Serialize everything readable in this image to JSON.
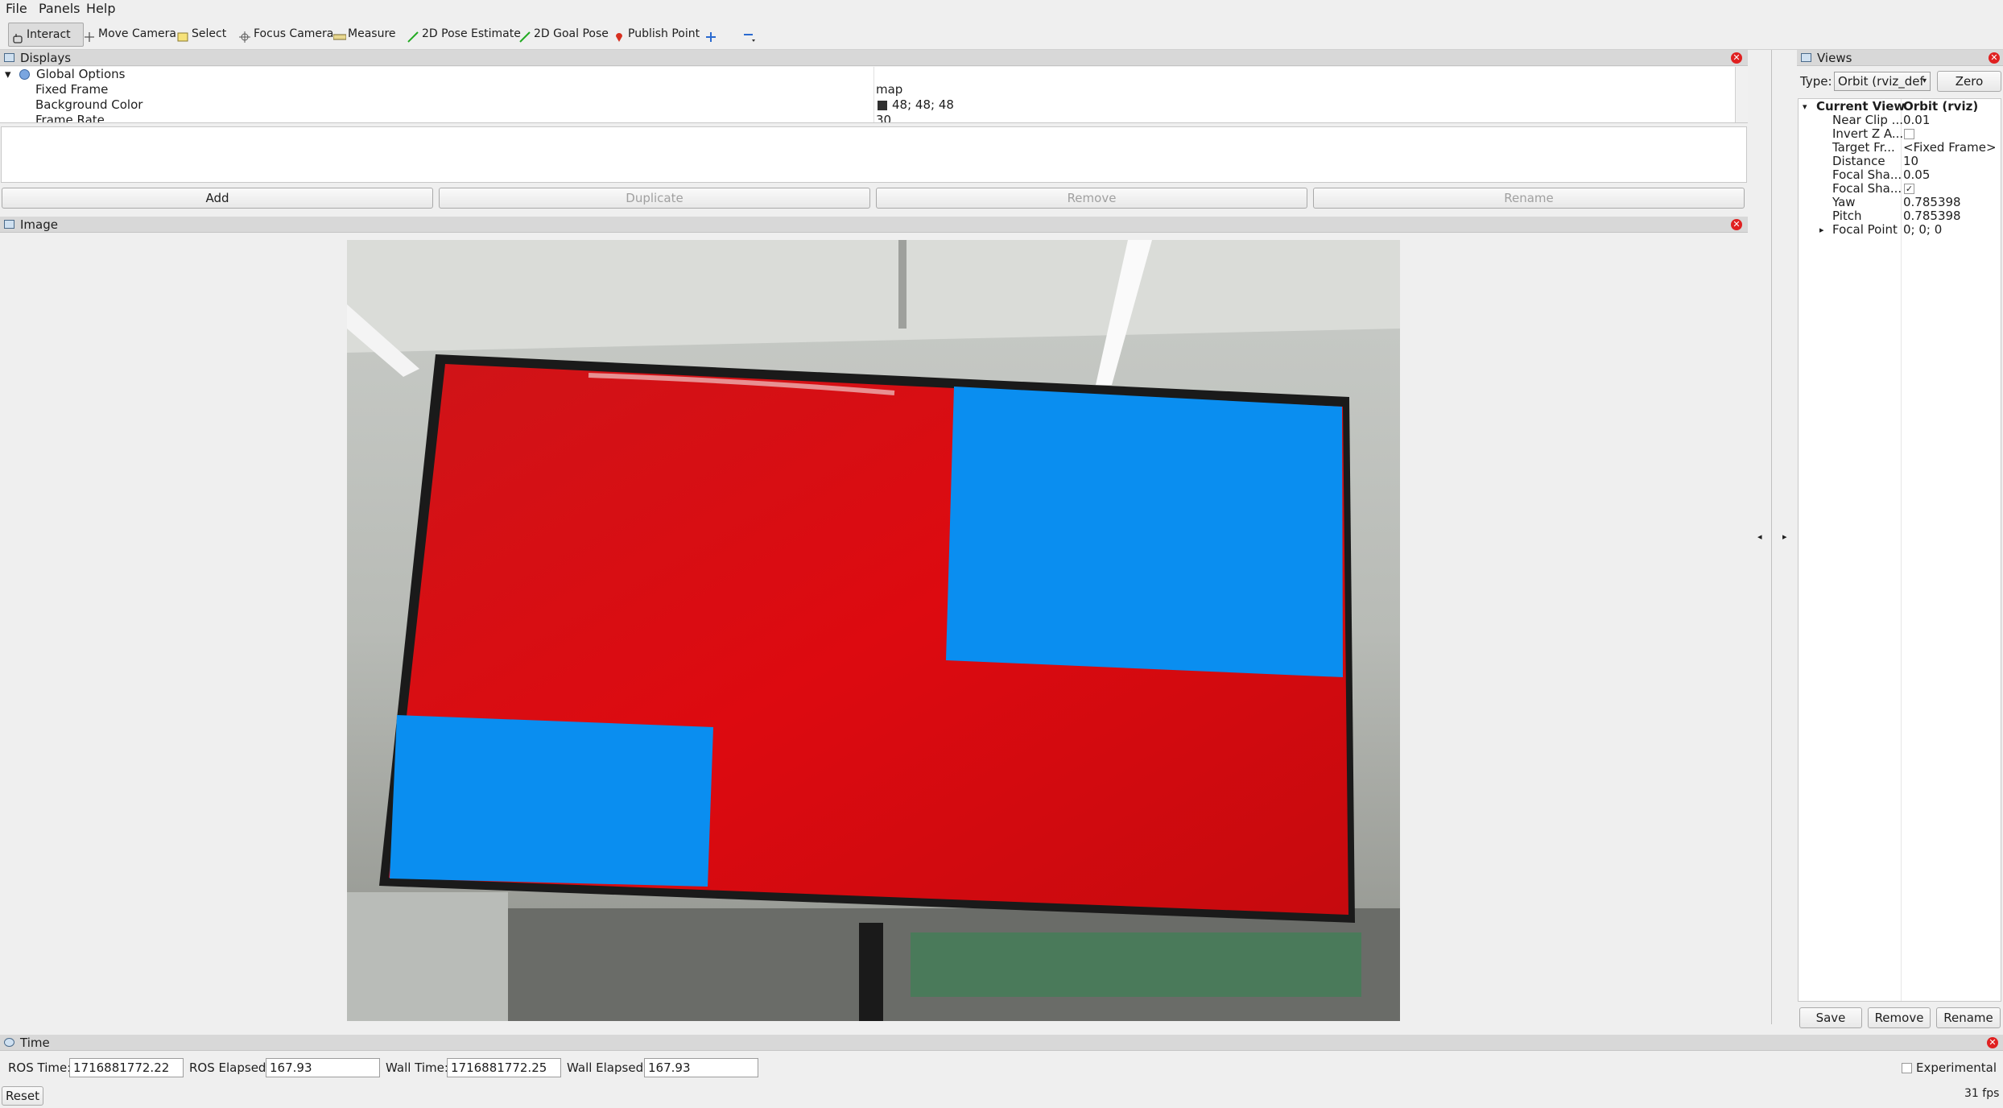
{
  "menu": {
    "file": "File",
    "panels": "Panels",
    "help": "Help"
  },
  "toolbar": {
    "interact": "Interact",
    "move_camera": "Move Camera",
    "select": "Select",
    "focus_camera": "Focus Camera",
    "measure": "Measure",
    "pose_estimate": "2D Pose Estimate",
    "goal_pose": "2D Goal Pose",
    "publish_point": "Publish Point"
  },
  "displays": {
    "title": "Displays",
    "global_options": "Global Options",
    "rows": [
      {
        "name": "Fixed Frame",
        "value": "map"
      },
      {
        "name": "Background Color",
        "value": "48; 48; 48",
        "swatch": "#303030"
      },
      {
        "name": "Frame Rate",
        "value": "30"
      }
    ],
    "buttons": {
      "add": "Add",
      "duplicate": "Duplicate",
      "remove": "Remove",
      "rename": "Rename"
    }
  },
  "image_panel": {
    "title": "Image"
  },
  "views": {
    "title": "Views",
    "type_label": "Type:",
    "type_value": "Orbit (rviz_def",
    "zero": "Zero",
    "current_view": "Current View",
    "current_view_value": "Orbit (rviz)",
    "rows": [
      {
        "name": "Near Clip ...",
        "value": "0.01"
      },
      {
        "name": "Invert Z A...",
        "value": ""
      },
      {
        "name": "Target Fr...",
        "value": "<Fixed Frame>"
      },
      {
        "name": "Distance",
        "value": "10"
      },
      {
        "name": "Focal Sha...",
        "value": "0.05"
      },
      {
        "name": "Focal Sha...",
        "value": ""
      },
      {
        "name": "Yaw",
        "value": "0.785398"
      },
      {
        "name": "Pitch",
        "value": "0.785398"
      },
      {
        "name": "Focal Point",
        "value": "0; 0; 0"
      }
    ],
    "invert_z_checked": false,
    "focal_shape_fixed_checked": true,
    "buttons": {
      "save": "Save",
      "remove": "Remove",
      "rename": "Rename"
    }
  },
  "time": {
    "title": "Time",
    "ros_time_label": "ROS Time:",
    "ros_time": "1716881772.22",
    "ros_elapsed_label": "ROS Elapsed:",
    "ros_elapsed": "167.93",
    "wall_time_label": "Wall Time:",
    "wall_time": "1716881772.25",
    "wall_elapsed_label": "Wall Elapsed:",
    "wall_elapsed": "167.93",
    "experimental": "Experimental",
    "reset": "Reset",
    "fps": "31 fps"
  },
  "colors": {
    "red_screen": "#d90a10",
    "blue_block": "#0a8ef0",
    "panel_header": "#d8d8d8"
  }
}
